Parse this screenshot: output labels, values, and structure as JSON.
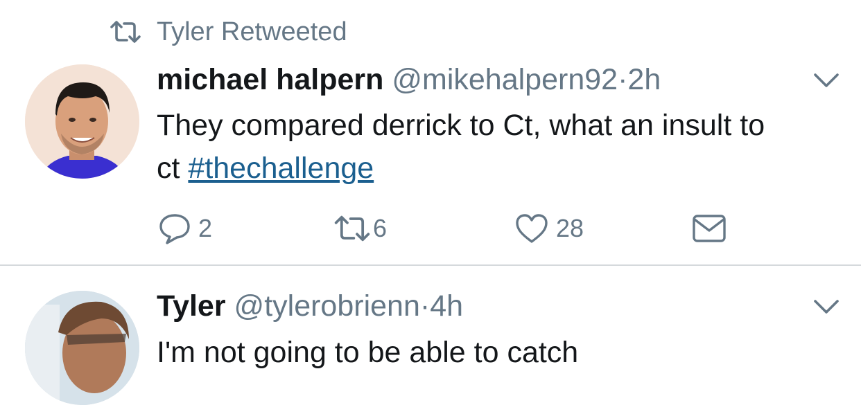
{
  "retweet_banner": {
    "text": "Tyler Retweeted",
    "icon": "retweet-icon"
  },
  "tweets": [
    {
      "name": "michael halpern",
      "handle": "@mikehalpern92",
      "separator": "·",
      "time": "2h",
      "text_before": "They compared derrick to Ct, what an insult to ct ",
      "hashtag": "#thechallenge",
      "counts": {
        "reply": "2",
        "retweet": "6",
        "like": "28"
      }
    },
    {
      "name": "Tyler",
      "handle": "@tylerobrienn",
      "separator": "·",
      "time": "4h",
      "text": "I'm not going to be able to catch"
    }
  ],
  "colors": {
    "text": "#14171a",
    "secondary": "#657786",
    "link": "#1b5f8f",
    "divider": "#d5d9dc"
  }
}
